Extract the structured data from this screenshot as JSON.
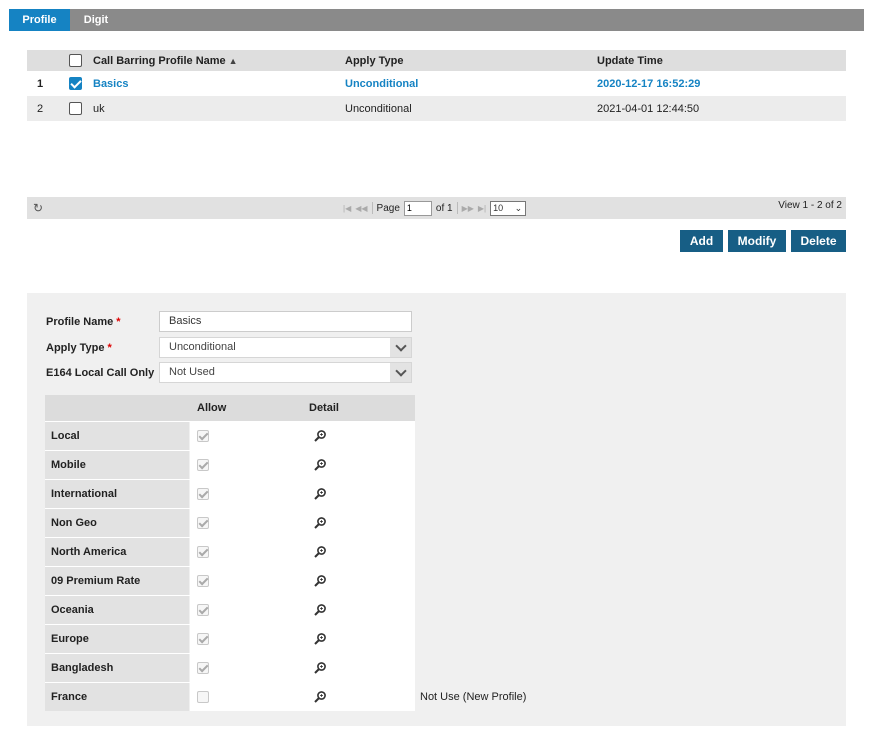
{
  "tabs": [
    {
      "label": "Profile",
      "active": true
    },
    {
      "label": "Digit",
      "active": false
    }
  ],
  "grid": {
    "headers": {
      "name": "Call Barring Profile Name",
      "apply_type": "Apply Type",
      "update_time": "Update Time"
    },
    "rows": [
      {
        "num": "1",
        "name": "Basics",
        "apply_type": "Unconditional",
        "update_time": "2020-12-17 16:52:29",
        "selected": true
      },
      {
        "num": "2",
        "name": "uk",
        "apply_type": "Unconditional",
        "update_time": "2021-04-01 12:44:50",
        "selected": false
      }
    ]
  },
  "pager": {
    "page_label": "Page",
    "page_value": "1",
    "of_label": "of 1",
    "rows_per_page": "10",
    "view_text": "View 1 - 2 of 2"
  },
  "buttons": {
    "add": "Add",
    "modify": "Modify",
    "delete": "Delete"
  },
  "form": {
    "profile_name_label": "Profile Name",
    "profile_name_value": "Basics",
    "apply_type_label": "Apply Type",
    "apply_type_value": "Unconditional",
    "e164_label": "E164 Local Call Only",
    "e164_value": "Not Used",
    "required_mark": "*"
  },
  "permissions": {
    "headers": {
      "allow": "Allow",
      "detail": "Detail"
    },
    "rows": [
      {
        "name": "Local",
        "allow": true,
        "note": ""
      },
      {
        "name": "Mobile",
        "allow": true,
        "note": ""
      },
      {
        "name": "International",
        "allow": true,
        "note": ""
      },
      {
        "name": "Non Geo",
        "allow": true,
        "note": ""
      },
      {
        "name": "North America",
        "allow": true,
        "note": ""
      },
      {
        "name": "09 Premium Rate",
        "allow": true,
        "note": ""
      },
      {
        "name": "Oceania",
        "allow": true,
        "note": ""
      },
      {
        "name": "Europe",
        "allow": true,
        "note": ""
      },
      {
        "name": "Bangladesh",
        "allow": true,
        "note": ""
      },
      {
        "name": "France",
        "allow": false,
        "note": "Not Use (New Profile)"
      }
    ]
  },
  "icons": {
    "refresh": "refresh-icon",
    "detail": "magnifier-icon",
    "sort": "sort-icon"
  },
  "colors": {
    "accent": "#1583c3",
    "button": "#175e85",
    "tabbar": "#8a8a8a"
  }
}
